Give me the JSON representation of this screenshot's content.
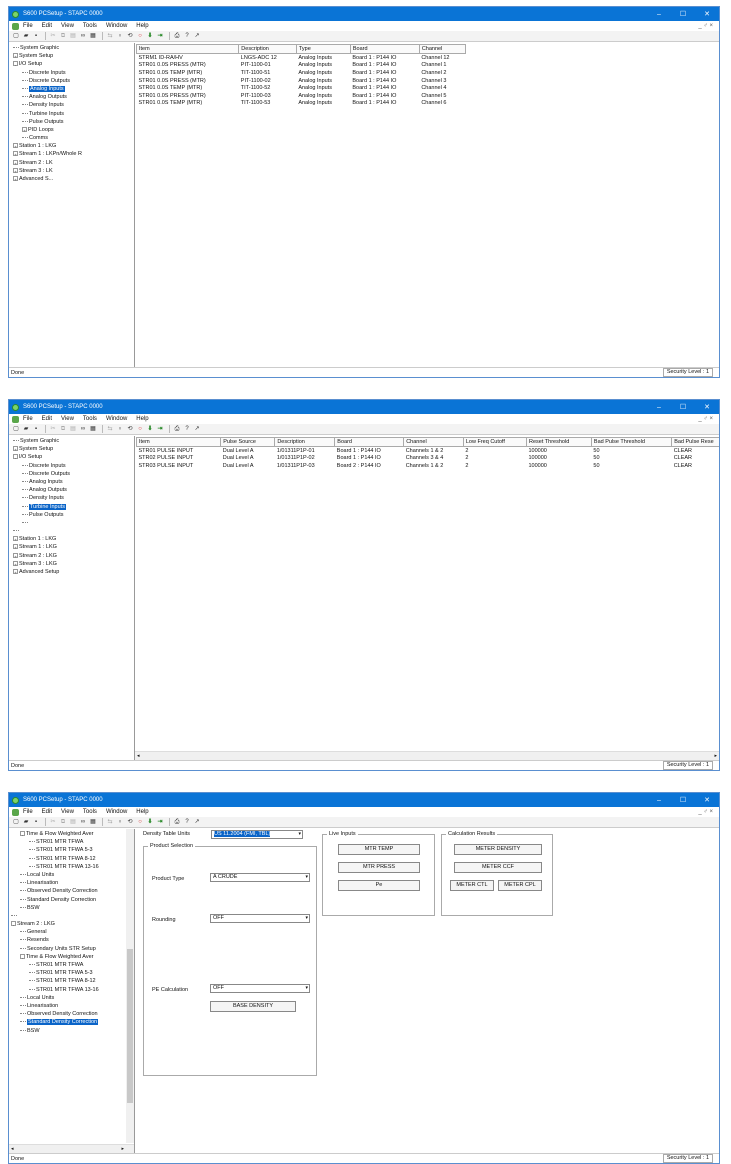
{
  "windows": [
    {
      "title": "S600 PCSetup - ",
      "title_filename": "STAPC 0000",
      "menu": [
        "File",
        "Edit",
        "View",
        "Tools",
        "Window",
        "Help"
      ],
      "mdi_controls": "_ ♂ ×",
      "tree": [
        {
          "label": "System Graphic",
          "exp": "",
          "indent": 0
        },
        {
          "label": "System Setup",
          "exp": "+",
          "indent": 0
        },
        {
          "label": "I/O Setup",
          "exp": "-",
          "indent": 0
        },
        {
          "label": "Discrete Inputs",
          "exp": "",
          "indent": 1
        },
        {
          "label": "Discrete Outputs",
          "exp": "",
          "indent": 1
        },
        {
          "label": "Analog Inputs",
          "exp": "",
          "indent": 1,
          "selected": true
        },
        {
          "label": "Analog Outputs",
          "exp": "",
          "indent": 1
        },
        {
          "label": "Density Inputs",
          "exp": "",
          "indent": 1
        },
        {
          "label": "Turbine Inputs",
          "exp": "",
          "indent": 1
        },
        {
          "label": "Pulse Outputs",
          "exp": "",
          "indent": 1
        },
        {
          "label": "PID Loops",
          "exp": "+",
          "indent": 1
        },
        {
          "label": "Comms",
          "exp": "",
          "indent": 1
        },
        {
          "label": "Station 1 : LKG",
          "exp": "+",
          "indent": 0
        },
        {
          "label": "Stream 1 : LKPn/Whole R",
          "exp": "+",
          "indent": 0
        },
        {
          "label": "Stream 2 : LK",
          "exp": "+",
          "indent": 0
        },
        {
          "label": "Stream 3 : LK",
          "exp": "+",
          "indent": 0
        },
        {
          "label": "Advanced S...",
          "exp": "+",
          "indent": 0
        }
      ],
      "columns": [
        "Item",
        "Description",
        "Type",
        "Board",
        "Channel"
      ],
      "rows": [
        [
          "STRM1 ID-RA/HV",
          "LNGS-ADC 12",
          "Analog Inputs",
          "Board 1 : P144 IO",
          "Channel 12"
        ],
        [
          "STR01 0.0S PRESS (MTR)",
          "PIT-1100-01",
          "Analog Inputs",
          "Board 1 : P144 IO",
          "Channel 1"
        ],
        [
          "STR01 0.0S TEMP (MTR)",
          "TIT-1100-51",
          "Analog Inputs",
          "Board 1 : P144 IO",
          "Channel 2"
        ],
        [
          "STR01 0.0S PRESS (MTR)",
          "PIT-1100-02",
          "Analog Inputs",
          "Board 1 : P144 IO",
          "Channel 3"
        ],
        [
          "STR01 0.0S TEMP (MTR)",
          "TIT-1100-52",
          "Analog Inputs",
          "Board 1 : P144 IO",
          "Channel 4"
        ],
        [
          "STR01 0.0S PRESS (MTR)",
          "PIT-1100-03",
          "Analog Inputs",
          "Board 1 : P144 IO",
          "Channel 5"
        ],
        [
          "STR01 0.0S TEMP (MTR)",
          "TIT-1100-53",
          "Analog Inputs",
          "Board 1 : P144 IO",
          "Channel 6"
        ]
      ],
      "status": "Done",
      "security": "Security Level : 1"
    },
    {
      "title": "S600 PCSetup - ",
      "title_filename": "STAPC 0000",
      "menu": [
        "File",
        "Edit",
        "View",
        "Tools",
        "Window",
        "Help"
      ],
      "mdi_controls": "_ ♂ ×",
      "tree": [
        {
          "label": "System Graphic",
          "exp": "",
          "indent": 0
        },
        {
          "label": "System Setup",
          "exp": "+",
          "indent": 0
        },
        {
          "label": "I/O Setup",
          "exp": "-",
          "indent": 0
        },
        {
          "label": "Discrete Inputs",
          "exp": "",
          "indent": 1
        },
        {
          "label": "Discrete Outputs",
          "exp": "",
          "indent": 1
        },
        {
          "label": "Analog Inputs",
          "exp": "",
          "indent": 1
        },
        {
          "label": "Analog Outputs",
          "exp": "",
          "indent": 1
        },
        {
          "label": "Density Inputs",
          "exp": "",
          "indent": 1
        },
        {
          "label": "Turbine Inputs",
          "exp": "",
          "indent": 1,
          "selected": true
        },
        {
          "label": "Pulse Outputs",
          "exp": "",
          "indent": 1
        },
        {
          "label": "",
          "exp": "",
          "indent": 1
        },
        {
          "label": "",
          "exp": "",
          "indent": 0
        },
        {
          "label": "Station 1 : LKG",
          "exp": "+",
          "indent": 0
        },
        {
          "label": "Stream 1 : LKG",
          "exp": "+",
          "indent": 0
        },
        {
          "label": "Stream 2 : LKG",
          "exp": "+",
          "indent": 0
        },
        {
          "label": "Stream 3 : LKG",
          "exp": "+",
          "indent": 0
        },
        {
          "label": "Advanced Setup",
          "exp": "+",
          "indent": 0
        }
      ],
      "columns": [
        "Item",
        "Pulse Source",
        "Description",
        "Board",
        "Channel",
        "Low Freq Cutoff",
        "Reset Threshold",
        "Bad Pulse Threshold",
        "Bad Pulse Rese"
      ],
      "rows": [
        [
          "STR01 PULSE INPUT",
          "Dual Level A",
          "1/01311P1P-01",
          "Board 1 : P144 IO",
          "Channels 1 & 2",
          "2",
          "100000",
          "50",
          "CLEAR"
        ],
        [
          "STR02 PULSE INPUT",
          "Dual Level A",
          "1/01311P1P-02",
          "Board 1 : P144 IO",
          "Channels 3 & 4",
          "2",
          "100000",
          "50",
          "CLEAR"
        ],
        [
          "STR03 PULSE INPUT",
          "Dual Level A",
          "1/01311P1P-03",
          "Board 2 : P144 IO",
          "Channels 1 & 2",
          "2",
          "100000",
          "50",
          "CLEAR"
        ]
      ],
      "status": "Done",
      "security": "Security Level : 1"
    },
    {
      "title": "S600 PCSetup - ",
      "title_filename": "STAPC 0000",
      "menu": [
        "File",
        "Edit",
        "View",
        "Tools",
        "Window",
        "Help"
      ],
      "mdi_controls": "_ ♂ ×",
      "tree": [
        {
          "label": "Time & Flow Weighted Aver",
          "exp": "-",
          "indent": 1
        },
        {
          "label": "STR01 MTR TFWA",
          "exp": "",
          "indent": 2
        },
        {
          "label": "STR01 MTR TFWA 5-3",
          "exp": "",
          "indent": 2
        },
        {
          "label": "STR01 MTR TFWA 8-12",
          "exp": "",
          "indent": 2
        },
        {
          "label": "STR01 MTR TFWA 13-16",
          "exp": "",
          "indent": 2
        },
        {
          "label": "Local Units",
          "exp": "",
          "indent": 1
        },
        {
          "label": "Linearisation",
          "exp": "",
          "indent": 1
        },
        {
          "label": "Observed Density Correction",
          "exp": "",
          "indent": 1
        },
        {
          "label": "Standard Density Correction",
          "exp": "",
          "indent": 1
        },
        {
          "label": "BSW",
          "exp": "",
          "indent": 1
        },
        {
          "label": "",
          "exp": "",
          "indent": 0
        },
        {
          "label": "Stream 2 : LKG",
          "exp": "-",
          "indent": 0
        },
        {
          "label": "General",
          "exp": "",
          "indent": 1
        },
        {
          "label": "Resends",
          "exp": "",
          "indent": 1
        },
        {
          "label": "Secondary Units STR Setup",
          "exp": "",
          "indent": 1
        },
        {
          "label": "Time & Flow Weighted Aver",
          "exp": "-",
          "indent": 1
        },
        {
          "label": "STR01 MTR TFWA",
          "exp": "",
          "indent": 2
        },
        {
          "label": "STR01 MTR TFWA 5-3",
          "exp": "",
          "indent": 2
        },
        {
          "label": "STR01 MTR TFWA 8-12",
          "exp": "",
          "indent": 2
        },
        {
          "label": "STR01 MTR TFWA 13-16",
          "exp": "",
          "indent": 2
        },
        {
          "label": "Local Units",
          "exp": "",
          "indent": 1
        },
        {
          "label": "Linearisation",
          "exp": "",
          "indent": 1
        },
        {
          "label": "Observed Density Correction",
          "exp": "",
          "indent": 1
        },
        {
          "label": "Standard Density Correction",
          "exp": "",
          "indent": 1,
          "selected": true
        },
        {
          "label": "BSW",
          "exp": "",
          "indent": 1
        }
      ],
      "density_table_label": "Density Table Units",
      "density_table_value": "US 11.2004 (FMI, TBL)",
      "product_selection_title": "Product Selection",
      "product_type_label": "Product Type",
      "product_type_value": "A CRUDE",
      "rounding_label": "Rounding",
      "rounding_value": "OFF",
      "pe_calc_label": "PE Calculation",
      "pe_calc_value": "OFF",
      "base_density_button": "BASE DENSITY",
      "live_inputs_title": "Live Inputs",
      "live_buttons": [
        "MTR TEMP",
        "MTR PRESS",
        "Pe"
      ],
      "calc_results_title": "Calculation Results",
      "calc_buttons": [
        "METER DENSITY",
        "METER CCF",
        "METER CTL",
        "METER CPL"
      ],
      "status": "Done",
      "security": "Security Level : 1"
    }
  ]
}
